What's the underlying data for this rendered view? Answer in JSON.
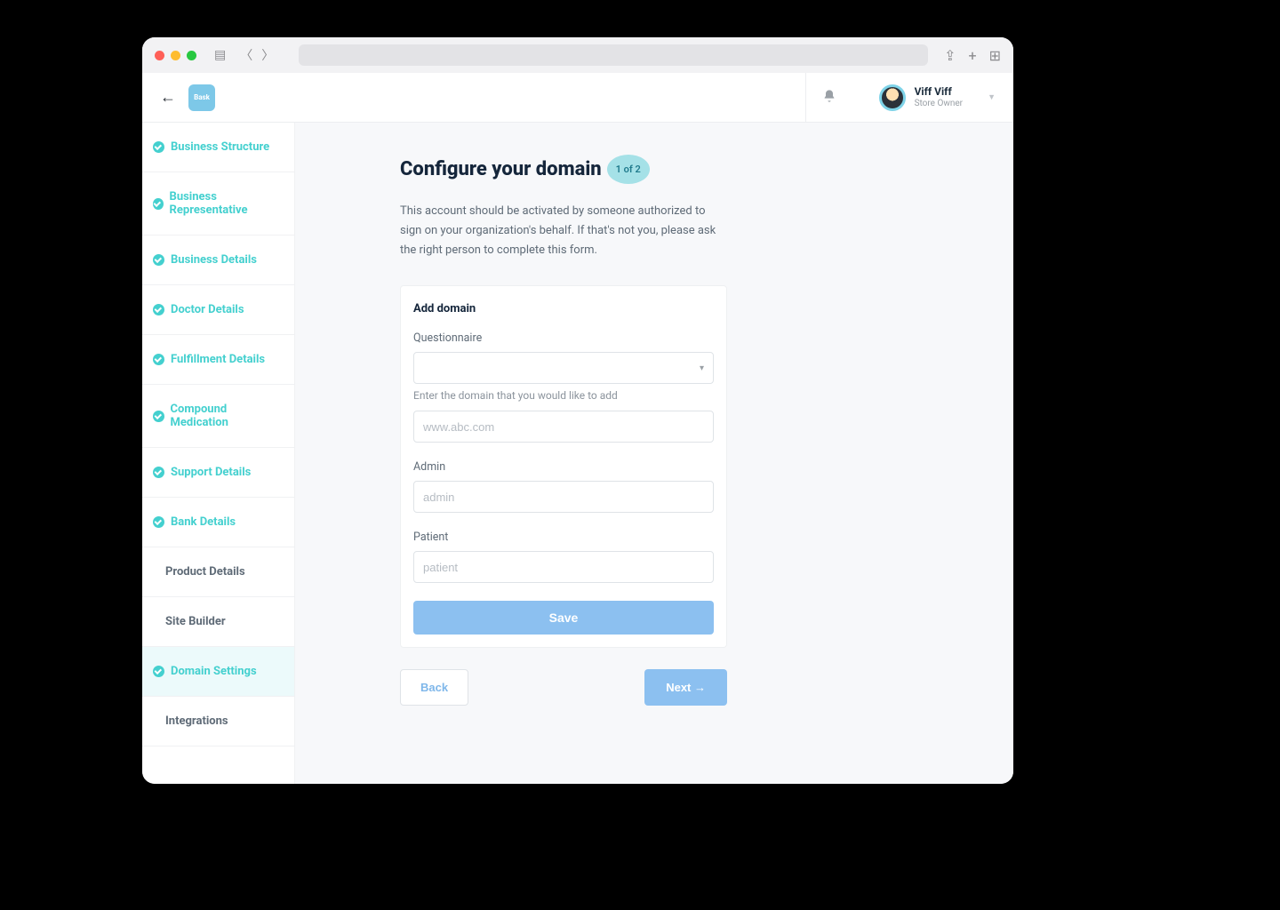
{
  "browser": {
    "sidebar_glyph": "▤",
    "share_glyph": "⇪",
    "plus_glyph": "+",
    "tabs_glyph": "⊞"
  },
  "header": {
    "logo_text": "Bask",
    "user_name": "Viff Viff",
    "user_role": "Store Owner"
  },
  "sidebar": {
    "items": [
      {
        "label": "Business Structure",
        "checked": true
      },
      {
        "label": "Business Representative",
        "checked": true
      },
      {
        "label": "Business Details",
        "checked": true
      },
      {
        "label": "Doctor Details",
        "checked": true
      },
      {
        "label": "Fulfillment Details",
        "checked": true
      },
      {
        "label": "Compound Medication",
        "checked": true
      },
      {
        "label": "Support Details",
        "checked": true
      },
      {
        "label": "Bank Details",
        "checked": true
      },
      {
        "label": "Product Details",
        "checked": false
      },
      {
        "label": "Site Builder",
        "checked": false
      },
      {
        "label": "Domain Settings",
        "checked": true,
        "active": true
      },
      {
        "label": "Integrations",
        "checked": false
      }
    ]
  },
  "main": {
    "title": "Configure your domain",
    "step": "1 of 2",
    "description": "This account should be activated by someone authorized to sign on your organization's behalf. If that's not you, please ask the right person to complete this form.",
    "card": {
      "title": "Add domain",
      "questionnaire_label": "Questionnaire",
      "domain_helper": "Enter the domain that you would like to add",
      "domain_placeholder": "www.abc.com",
      "admin_label": "Admin",
      "admin_placeholder": "admin",
      "patient_label": "Patient",
      "patient_placeholder": "patient",
      "save_label": "Save"
    },
    "back_label": "Back",
    "next_label": "Next →"
  }
}
